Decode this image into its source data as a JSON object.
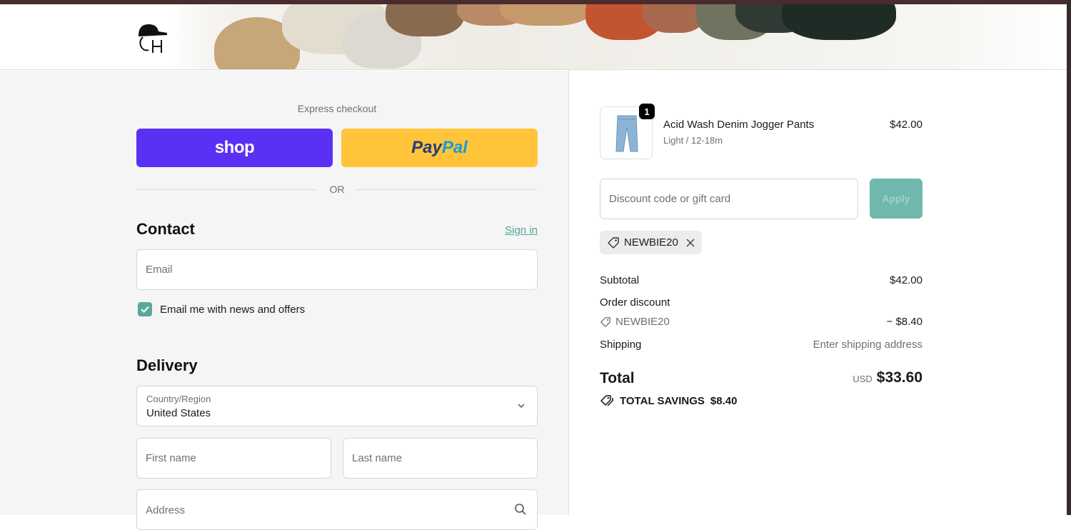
{
  "header": {
    "logo_alt": "GH"
  },
  "express": {
    "label": "Express checkout",
    "shop_label": "shop",
    "paypal_part1": "Pay",
    "paypal_part2": "Pal",
    "or_text": "OR"
  },
  "contact": {
    "heading": "Contact",
    "sign_in": "Sign in",
    "email_placeholder": "Email",
    "news_label": "Email me with news and offers",
    "news_checked": true
  },
  "delivery": {
    "heading": "Delivery",
    "country_label": "Country/Region",
    "country_value": "United States",
    "first_name_placeholder": "First name",
    "last_name_placeholder": "Last name",
    "address_placeholder": "Address"
  },
  "order": {
    "product": {
      "name": "Acid Wash Denim Jogger Pants",
      "variant": "Light / 12-18m",
      "price": "$42.00",
      "quantity": "1"
    },
    "discount_placeholder": "Discount code or gift card",
    "apply_label": "Apply",
    "applied_code": "NEWBIE20",
    "subtotal_label": "Subtotal",
    "subtotal_value": "$42.00",
    "order_discount_label": "Order discount",
    "discount_code": "NEWBIE20",
    "discount_value": "− $8.40",
    "shipping_label": "Shipping",
    "shipping_value": "Enter shipping address",
    "total_label": "Total",
    "currency": "USD",
    "total_value": "$33.60",
    "savings_label": "TOTAL SAVINGS",
    "savings_value": "$8.40"
  },
  "colors": {
    "shop_purple": "#5a31f4",
    "paypal_yellow": "#ffc439",
    "accent_teal": "#5aa89d"
  }
}
